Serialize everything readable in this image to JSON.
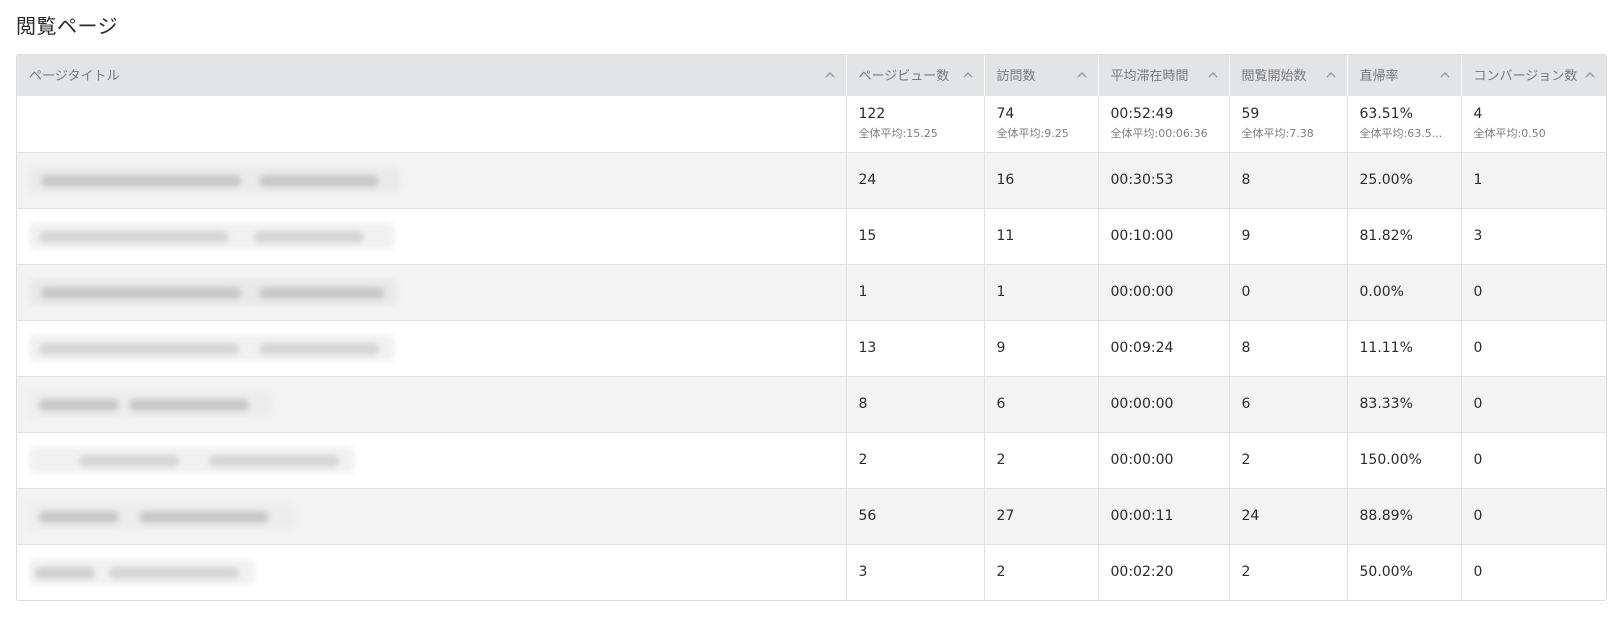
{
  "page_title": "閲覧ページ",
  "icons": {
    "sort": "chevron-up-icon"
  },
  "colors": {
    "header_bg": "#e3e4e6",
    "row_alt_bg": "#f3f3f3"
  },
  "table": {
    "columns": [
      {
        "key": "page_title",
        "label": "ページタイトル"
      },
      {
        "key": "page_views",
        "label": "ページビュー数"
      },
      {
        "key": "visits",
        "label": "訪問数"
      },
      {
        "key": "avg_time",
        "label": "平均滞在時間"
      },
      {
        "key": "entrances",
        "label": "閲覧開始数"
      },
      {
        "key": "bounce_rate",
        "label": "直帰率"
      },
      {
        "key": "conversions",
        "label": "コンバージョン数"
      }
    ],
    "summary": {
      "page_views": {
        "value": "122",
        "avg": "全体平均:15.25"
      },
      "visits": {
        "value": "74",
        "avg": "全体平均:9.25"
      },
      "avg_time": {
        "value": "00:52:49",
        "avg": "全体平均:00:06:36"
      },
      "entrances": {
        "value": "59",
        "avg": "全体平均:7.38"
      },
      "bounce_rate": {
        "value": "63.51%",
        "avg": "全体平均:63.5..."
      },
      "conversions": {
        "value": "4",
        "avg": "全体平均:0.50"
      }
    },
    "rows": [
      {
        "title_blurred": true,
        "page_views": "24",
        "visits": "16",
        "avg_time": "00:30:53",
        "entrances": "8",
        "bounce_rate": "25.00%",
        "conversions": "1"
      },
      {
        "title_blurred": true,
        "page_views": "15",
        "visits": "11",
        "avg_time": "00:10:00",
        "entrances": "9",
        "bounce_rate": "81.82%",
        "conversions": "3"
      },
      {
        "title_blurred": true,
        "page_views": "1",
        "visits": "1",
        "avg_time": "00:00:00",
        "entrances": "0",
        "bounce_rate": "0.00%",
        "conversions": "0"
      },
      {
        "title_blurred": true,
        "page_views": "13",
        "visits": "9",
        "avg_time": "00:09:24",
        "entrances": "8",
        "bounce_rate": "11.11%",
        "conversions": "0"
      },
      {
        "title_blurred": true,
        "page_views": "8",
        "visits": "6",
        "avg_time": "00:00:00",
        "entrances": "6",
        "bounce_rate": "83.33%",
        "conversions": "0"
      },
      {
        "title_blurred": true,
        "page_views": "2",
        "visits": "2",
        "avg_time": "00:00:00",
        "entrances": "2",
        "bounce_rate": "150.00%",
        "conversions": "0"
      },
      {
        "title_blurred": true,
        "page_views": "56",
        "visits": "27",
        "avg_time": "00:00:11",
        "entrances": "24",
        "bounce_rate": "88.89%",
        "conversions": "0"
      },
      {
        "title_blurred": true,
        "page_views": "3",
        "visits": "2",
        "avg_time": "00:02:20",
        "entrances": "2",
        "bounce_rate": "50.00%",
        "conversions": "0"
      }
    ]
  }
}
